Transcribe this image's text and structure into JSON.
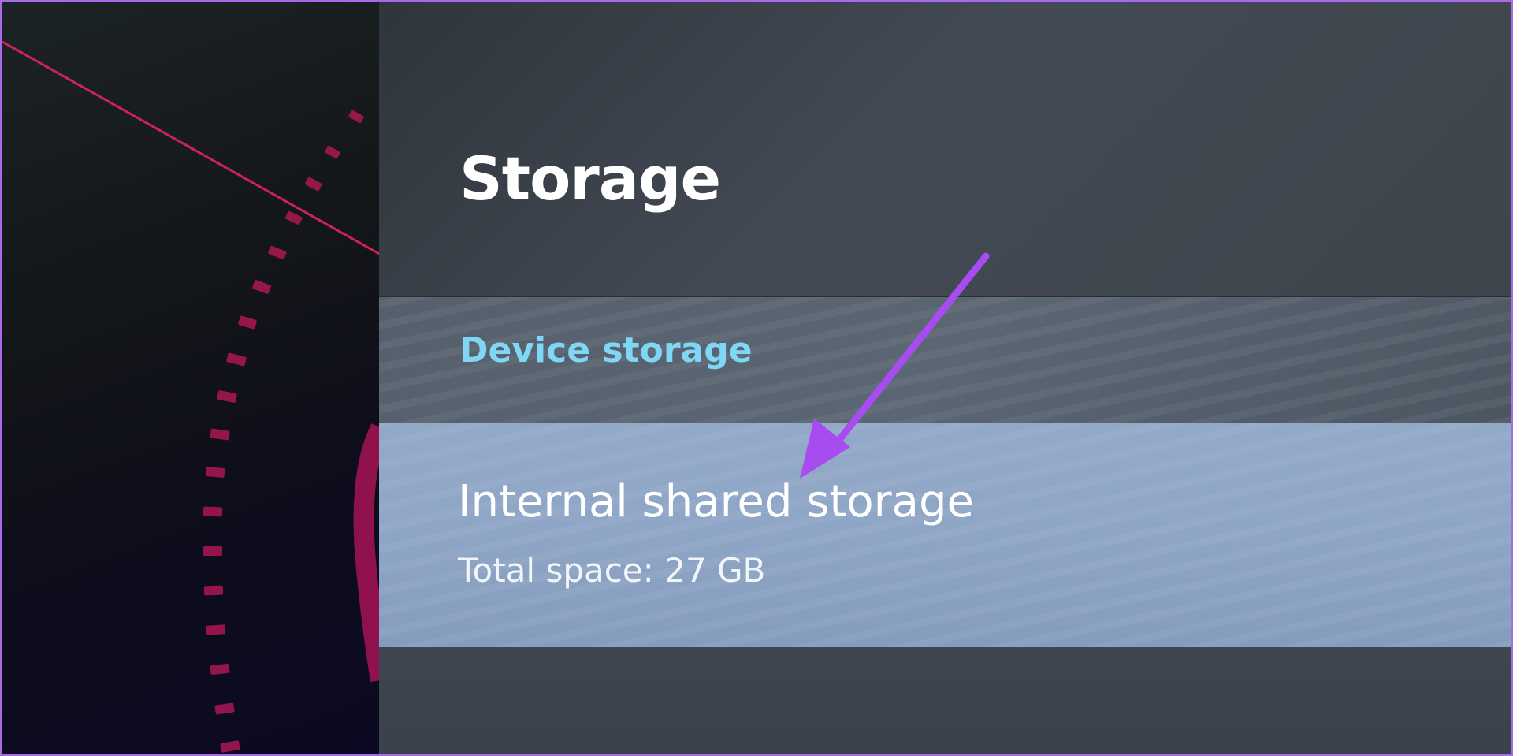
{
  "screen": {
    "title": "Storage",
    "section_header": "Device storage",
    "storage_item": {
      "title": "Internal shared storage",
      "subtitle": "Total space: 27 GB"
    }
  },
  "colors": {
    "section_header": "#7fd6f5",
    "annotation_arrow": "#a64cf0",
    "frame_border": "#a86be8"
  },
  "annotation": {
    "icon": "arrow-pointer-icon"
  }
}
